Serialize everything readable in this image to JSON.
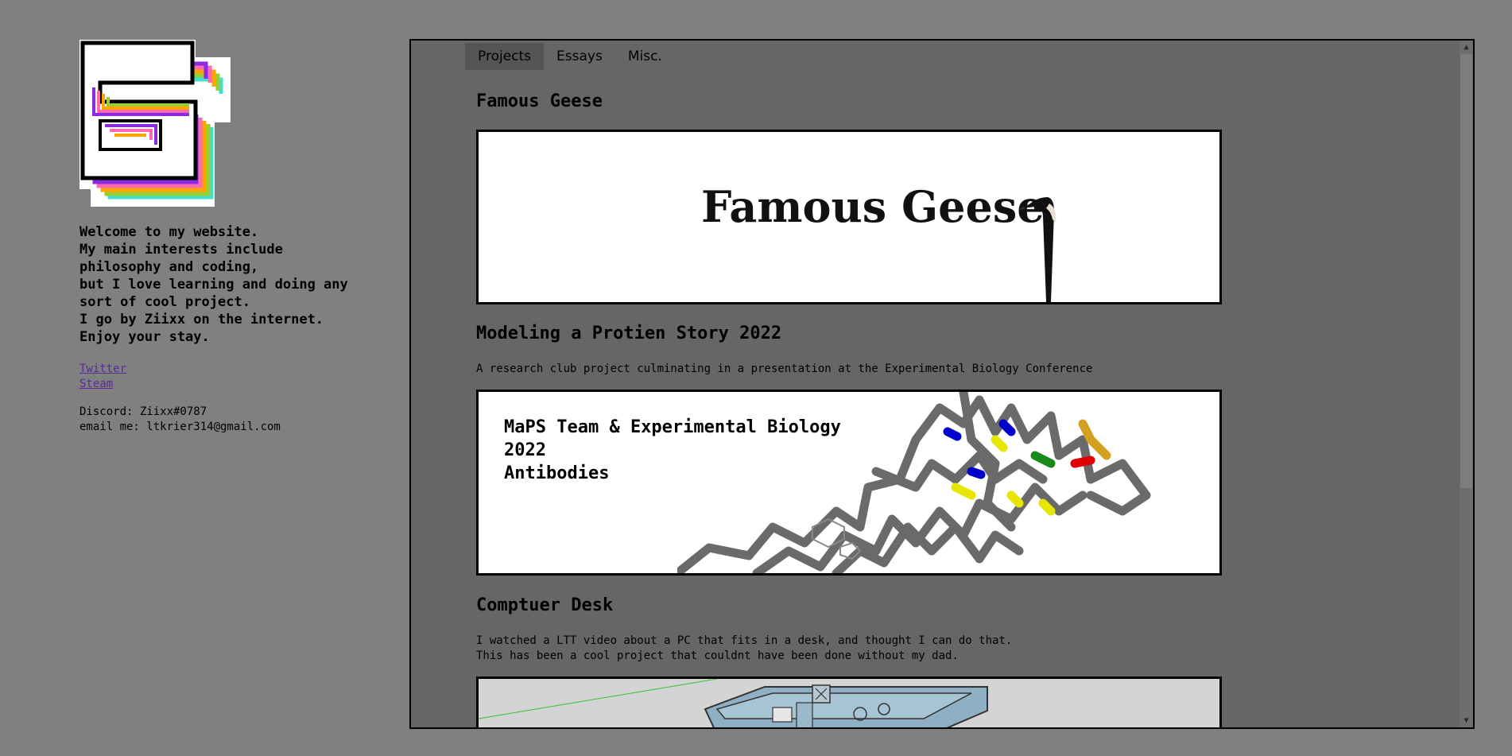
{
  "sidebar": {
    "intro_lines": [
      "Welcome to my website.",
      "My main interests include",
      "philosophy and coding,",
      "but I love learning and doing any",
      "sort of cool project.",
      "I go by Ziixx on the internet.",
      "Enjoy your stay."
    ],
    "links": [
      "Twitter",
      "Steam"
    ],
    "discord": "Discord: Ziixx#0787",
    "email": "email me: ltkrier314@gmail.com"
  },
  "nav": {
    "tabs": [
      "Projects",
      "Essays",
      "Misc."
    ],
    "active_tab": "Projects"
  },
  "projects": [
    {
      "title": "Famous Geese",
      "description": "",
      "banner_text": "Famous Geese"
    },
    {
      "title": "Modeling a Protien Story 2022",
      "description": "A research club project culminating in a presentation at the Experimental Biology Conference",
      "banner_lines": [
        "MaPS Team & Experimental Biology",
        "2022",
        "Antibodies"
      ]
    },
    {
      "title": "Comptuer Desk",
      "description_lines": [
        "I watched a LTT video about a PC that fits in a desk, and thought I can do that.",
        "This has been a cool project that couldnt have been done without my dad."
      ]
    }
  ],
  "colors": {
    "page_bg": "#808080",
    "frame_bg": "#666666",
    "active_tab_bg": "#555555",
    "link": "#5a2a9a",
    "logo_stripes": [
      "#ff7a1a",
      "#ffe640",
      "#7cff7a",
      "#40d0ff",
      "#ff40d0",
      "#8a2be2"
    ]
  },
  "icons": {
    "scroll_up": "scroll-up-arrow-icon",
    "scroll_down": "scroll-down-arrow-icon",
    "logo": "rainbow-digit-logo"
  }
}
